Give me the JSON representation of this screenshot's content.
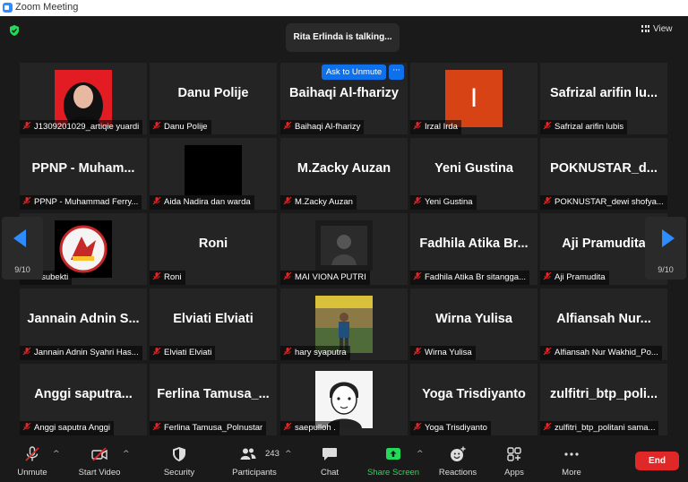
{
  "window": {
    "title": "Zoom Meeting"
  },
  "top": {
    "talking_text": "Rita Erlinda is talking...",
    "view_label": "View"
  },
  "overlay": {
    "ask_unmute": "Ask to Unmute",
    "more": "···"
  },
  "nav": {
    "left_page": "9/10",
    "right_page": "9/10"
  },
  "tiles": [
    {
      "big": "",
      "label": "J1309201029_artiqie yuardi"
    },
    {
      "big": "Danu Polije",
      "label": "Danu Polije"
    },
    {
      "big": "Baihaqi Al-fharizy",
      "label": "Baihaqi Al-fharizy"
    },
    {
      "big": "",
      "label": "Irzal Irda",
      "avatar_letter": "I"
    },
    {
      "big": "Safrizal arifin lu...",
      "label": "Safrizal arifin lubis"
    },
    {
      "big": "PPNP - Muham...",
      "label": "PPNP - Muhammad Ferry..."
    },
    {
      "big": "",
      "label": "Aida Nadira dan warda"
    },
    {
      "big": "M.Zacky Auzan",
      "label": "M.Zacky Auzan"
    },
    {
      "big": "Yeni Gustina",
      "label": "Yeni Gustina"
    },
    {
      "big": "POKNUSTAR_d...",
      "label": "POKNUSTAR_dewi shofya..."
    },
    {
      "big": "",
      "label": "ham subekti"
    },
    {
      "big": "Roni",
      "label": "Roni"
    },
    {
      "big": "",
      "label": "MAI VIONA PUTRI"
    },
    {
      "big": "Fadhila Atika Br...",
      "label": "Fadhila Atika Br sitangga..."
    },
    {
      "big": "Aji Pramudita",
      "label": "Aji Pramudita"
    },
    {
      "big": "Jannain Adnin S...",
      "label": "Jannain Adnin Syahri Has..."
    },
    {
      "big": "Elviati Elviati",
      "label": "Elviati Elviati"
    },
    {
      "big": "",
      "label": "hary syaputra"
    },
    {
      "big": "Wirna Yulisa",
      "label": "Wirna Yulisa"
    },
    {
      "big": "Alfiansah Nur...",
      "label": "Alfiansah Nur Wakhid_Po..."
    },
    {
      "big": "Anggi saputra...",
      "label": "Anggi saputra Anggi"
    },
    {
      "big": "Ferlina Tamusa_...",
      "label": "Ferlina Tamusa_Polnustar"
    },
    {
      "big": "",
      "label": "saepulloh ."
    },
    {
      "big": "Yoga Trisdiyanto",
      "label": "Yoga Trisdiyanto"
    },
    {
      "big": "zulfitri_btp_poli...",
      "label": "zulfitri_btp_politani sama..."
    }
  ],
  "toolbar": {
    "unmute": "Unmute",
    "start_video": "Start Video",
    "security": "Security",
    "participants": "Participants",
    "participants_count": "243",
    "chat": "Chat",
    "share_screen": "Share Screen",
    "reactions": "Reactions",
    "apps": "Apps",
    "more": "More",
    "end": "End"
  },
  "colors": {
    "accent": "#0e71eb",
    "share_green": "#23d959",
    "end_red": "#e02828",
    "avatar_orange": "#d84315"
  }
}
